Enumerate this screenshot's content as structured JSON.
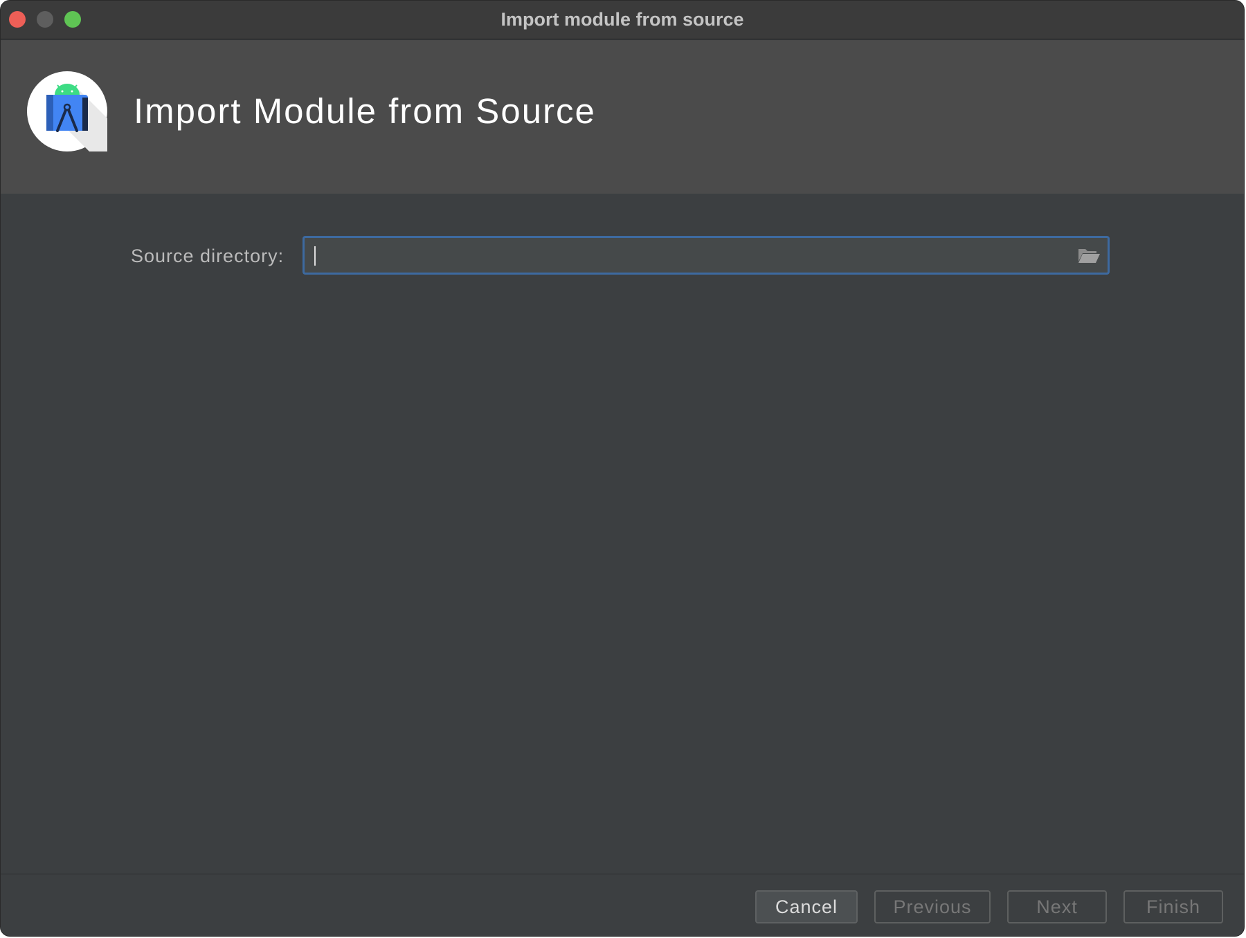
{
  "window": {
    "title": "Import module from source"
  },
  "header": {
    "title": "Import Module from Source",
    "logo_icon": "android-studio-logo-icon"
  },
  "form": {
    "source_label": "Source directory:",
    "source_value": "",
    "browse_icon": "folder-open-icon"
  },
  "footer": {
    "cancel_label": "Cancel",
    "previous_label": "Previous",
    "next_label": "Next",
    "finish_label": "Finish"
  },
  "colors": {
    "window_bg": "#3c3f41",
    "header_bg": "#4b4b4b",
    "focus_border": "#3d6aa0",
    "close": "#ee5f57",
    "maximize": "#5fc454"
  }
}
